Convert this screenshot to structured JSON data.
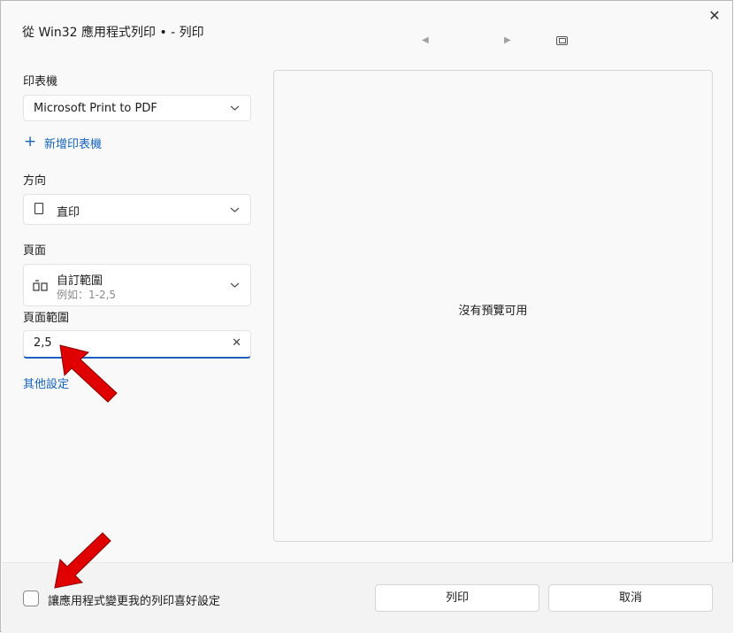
{
  "window": {
    "title": "從 Win32 應用程式列印 • - 列印",
    "close_icon": "✕",
    "prev_icon": "◀",
    "next_icon": "▶"
  },
  "printer": {
    "label": "印表機",
    "selected": "Microsoft Print to PDF",
    "add_link": "新增印表機",
    "plus_icon": "+"
  },
  "orientation": {
    "label": "方向",
    "selected": "直印"
  },
  "pages": {
    "label": "頁面",
    "selected": "自訂範圍",
    "hint": "例如：1-2,5"
  },
  "page_range": {
    "label": "頁面範圍",
    "value": "2,5"
  },
  "more_settings": "其他設定",
  "preview": {
    "message": "沒有預覽可用"
  },
  "footer": {
    "checkbox_label": "讓應用程式變更我的列印喜好設定",
    "print_button": "列印",
    "cancel_button": "取消"
  },
  "colors": {
    "accent": "#1563c0",
    "annotation_arrow": "#e00000"
  }
}
